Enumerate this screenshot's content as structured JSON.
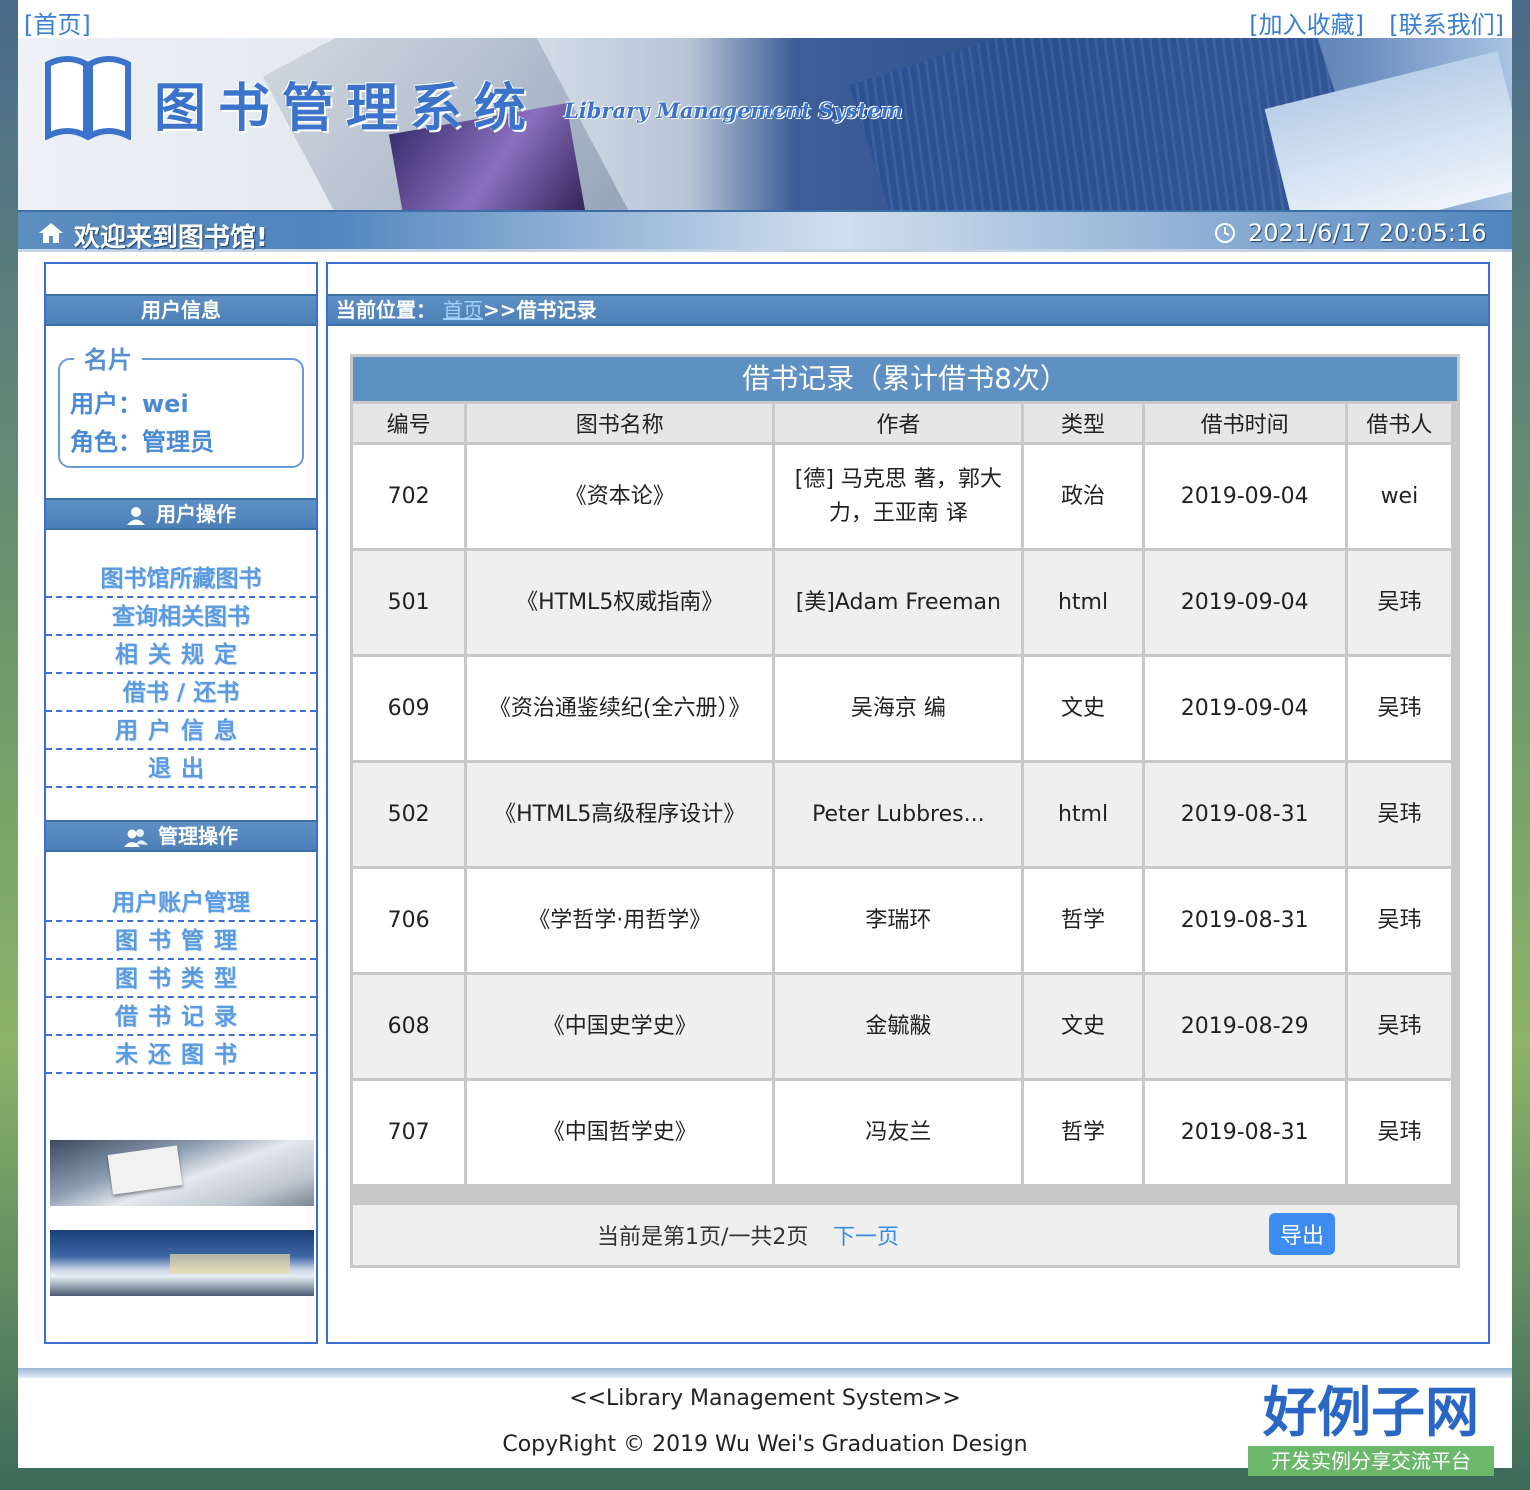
{
  "top_links": {
    "home": "[首页]",
    "favorite": "[加入收藏]",
    "contact": "[联系我们]"
  },
  "banner": {
    "title": "图书管理系统",
    "subtitle": "Library Management System"
  },
  "welcome_bar": {
    "welcome": "欢迎来到图书馆!",
    "datetime": "2021/6/17 20:05:16"
  },
  "sidebar": {
    "user_info_header": "用户信息",
    "card": {
      "legend": "名片",
      "user_line": "用户：wei",
      "role_line": "角色：管理员"
    },
    "user_ops_header": "用户操作",
    "user_ops": [
      {
        "label": "图书馆所藏图书"
      },
      {
        "label": "查询相关图书"
      },
      {
        "label": "相关规定"
      },
      {
        "label": "借书 / 还书"
      },
      {
        "label": "用户信息"
      },
      {
        "label": "退出"
      }
    ],
    "admin_ops_header": "管理操作",
    "admin_ops": [
      {
        "label": "用户账户管理"
      },
      {
        "label": "图书管理"
      },
      {
        "label": "图书类型"
      },
      {
        "label": "借书记录"
      },
      {
        "label": "未还图书"
      }
    ]
  },
  "breadcrumb": {
    "prefix": "当前位置：",
    "home": "首页",
    "current": ">>借书记录"
  },
  "table": {
    "title": "借书记录（累计借书8次）",
    "columns": [
      "编号",
      "图书名称",
      "作者",
      "类型",
      "借书时间",
      "借书人"
    ],
    "rows": [
      [
        "702",
        "《资本论》",
        "[德] 马克思 著，郭大力，王亚南 译",
        "政治",
        "2019-09-04",
        "wei"
      ],
      [
        "501",
        "《HTML5权威指南》",
        "[美]Adam Freeman",
        "html",
        "2019-09-04",
        "吴玮"
      ],
      [
        "609",
        "《资治通鉴续纪(全六册）》",
        "吴海京 编",
        "文史",
        "2019-09-04",
        "吴玮"
      ],
      [
        "502",
        "《HTML5高级程序设计》",
        "Peter Lubbres...",
        "html",
        "2019-08-31",
        "吴玮"
      ],
      [
        "706",
        "《学哲学·用哲学》",
        "李瑞环",
        "哲学",
        "2019-08-31",
        "吴玮"
      ],
      [
        "608",
        "《中国史学史》",
        "金毓黻",
        "文史",
        "2019-08-29",
        "吴玮"
      ],
      [
        "707",
        "《中国哲学史》",
        "冯友兰",
        "哲学",
        "2019-08-31",
        "吴玮"
      ]
    ]
  },
  "pager": {
    "text": "当前是第1页/一共2页",
    "next": "下一页",
    "export": "导出"
  },
  "footer": {
    "line1": "<<Library Management System>>",
    "line2": "CopyRight © 2019  Wu Wei's Graduation Design"
  },
  "brand": {
    "name": "好例子网",
    "tagline": "开发实例分享交流平台"
  },
  "colors": {
    "accent": "#5f90c4",
    "link": "#3a7fd0",
    "border": "#3a6fd0",
    "button": "#3f8cf0"
  }
}
